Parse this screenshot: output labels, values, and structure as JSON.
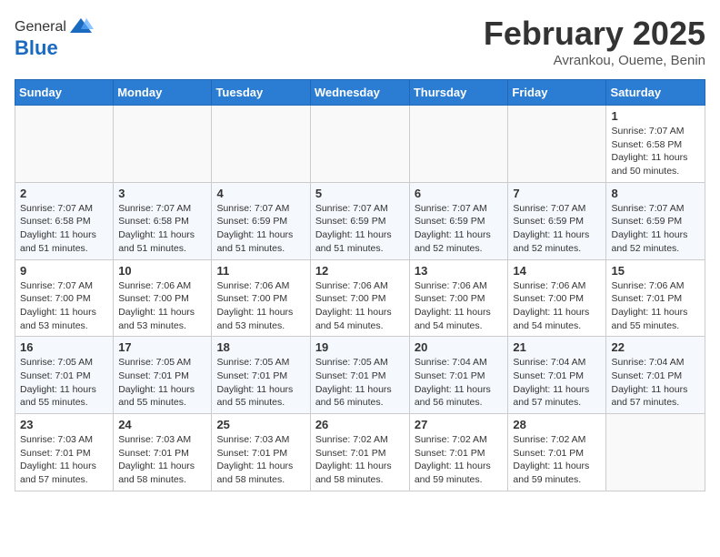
{
  "header": {
    "logo_general": "General",
    "logo_blue": "Blue",
    "title": "February 2025",
    "location": "Avrankou, Oueme, Benin"
  },
  "weekdays": [
    "Sunday",
    "Monday",
    "Tuesday",
    "Wednesday",
    "Thursday",
    "Friday",
    "Saturday"
  ],
  "weeks": [
    [
      {
        "day": "",
        "info": ""
      },
      {
        "day": "",
        "info": ""
      },
      {
        "day": "",
        "info": ""
      },
      {
        "day": "",
        "info": ""
      },
      {
        "day": "",
        "info": ""
      },
      {
        "day": "",
        "info": ""
      },
      {
        "day": "1",
        "info": "Sunrise: 7:07 AM\nSunset: 6:58 PM\nDaylight: 11 hours\nand 50 minutes."
      }
    ],
    [
      {
        "day": "2",
        "info": "Sunrise: 7:07 AM\nSunset: 6:58 PM\nDaylight: 11 hours\nand 51 minutes."
      },
      {
        "day": "3",
        "info": "Sunrise: 7:07 AM\nSunset: 6:58 PM\nDaylight: 11 hours\nand 51 minutes."
      },
      {
        "day": "4",
        "info": "Sunrise: 7:07 AM\nSunset: 6:59 PM\nDaylight: 11 hours\nand 51 minutes."
      },
      {
        "day": "5",
        "info": "Sunrise: 7:07 AM\nSunset: 6:59 PM\nDaylight: 11 hours\nand 51 minutes."
      },
      {
        "day": "6",
        "info": "Sunrise: 7:07 AM\nSunset: 6:59 PM\nDaylight: 11 hours\nand 52 minutes."
      },
      {
        "day": "7",
        "info": "Sunrise: 7:07 AM\nSunset: 6:59 PM\nDaylight: 11 hours\nand 52 minutes."
      },
      {
        "day": "8",
        "info": "Sunrise: 7:07 AM\nSunset: 6:59 PM\nDaylight: 11 hours\nand 52 minutes."
      }
    ],
    [
      {
        "day": "9",
        "info": "Sunrise: 7:07 AM\nSunset: 7:00 PM\nDaylight: 11 hours\nand 53 minutes."
      },
      {
        "day": "10",
        "info": "Sunrise: 7:06 AM\nSunset: 7:00 PM\nDaylight: 11 hours\nand 53 minutes."
      },
      {
        "day": "11",
        "info": "Sunrise: 7:06 AM\nSunset: 7:00 PM\nDaylight: 11 hours\nand 53 minutes."
      },
      {
        "day": "12",
        "info": "Sunrise: 7:06 AM\nSunset: 7:00 PM\nDaylight: 11 hours\nand 54 minutes."
      },
      {
        "day": "13",
        "info": "Sunrise: 7:06 AM\nSunset: 7:00 PM\nDaylight: 11 hours\nand 54 minutes."
      },
      {
        "day": "14",
        "info": "Sunrise: 7:06 AM\nSunset: 7:00 PM\nDaylight: 11 hours\nand 54 minutes."
      },
      {
        "day": "15",
        "info": "Sunrise: 7:06 AM\nSunset: 7:01 PM\nDaylight: 11 hours\nand 55 minutes."
      }
    ],
    [
      {
        "day": "16",
        "info": "Sunrise: 7:05 AM\nSunset: 7:01 PM\nDaylight: 11 hours\nand 55 minutes."
      },
      {
        "day": "17",
        "info": "Sunrise: 7:05 AM\nSunset: 7:01 PM\nDaylight: 11 hours\nand 55 minutes."
      },
      {
        "day": "18",
        "info": "Sunrise: 7:05 AM\nSunset: 7:01 PM\nDaylight: 11 hours\nand 55 minutes."
      },
      {
        "day": "19",
        "info": "Sunrise: 7:05 AM\nSunset: 7:01 PM\nDaylight: 11 hours\nand 56 minutes."
      },
      {
        "day": "20",
        "info": "Sunrise: 7:04 AM\nSunset: 7:01 PM\nDaylight: 11 hours\nand 56 minutes."
      },
      {
        "day": "21",
        "info": "Sunrise: 7:04 AM\nSunset: 7:01 PM\nDaylight: 11 hours\nand 57 minutes."
      },
      {
        "day": "22",
        "info": "Sunrise: 7:04 AM\nSunset: 7:01 PM\nDaylight: 11 hours\nand 57 minutes."
      }
    ],
    [
      {
        "day": "23",
        "info": "Sunrise: 7:03 AM\nSunset: 7:01 PM\nDaylight: 11 hours\nand 57 minutes."
      },
      {
        "day": "24",
        "info": "Sunrise: 7:03 AM\nSunset: 7:01 PM\nDaylight: 11 hours\nand 58 minutes."
      },
      {
        "day": "25",
        "info": "Sunrise: 7:03 AM\nSunset: 7:01 PM\nDaylight: 11 hours\nand 58 minutes."
      },
      {
        "day": "26",
        "info": "Sunrise: 7:02 AM\nSunset: 7:01 PM\nDaylight: 11 hours\nand 58 minutes."
      },
      {
        "day": "27",
        "info": "Sunrise: 7:02 AM\nSunset: 7:01 PM\nDaylight: 11 hours\nand 59 minutes."
      },
      {
        "day": "28",
        "info": "Sunrise: 7:02 AM\nSunset: 7:01 PM\nDaylight: 11 hours\nand 59 minutes."
      },
      {
        "day": "",
        "info": ""
      }
    ]
  ]
}
